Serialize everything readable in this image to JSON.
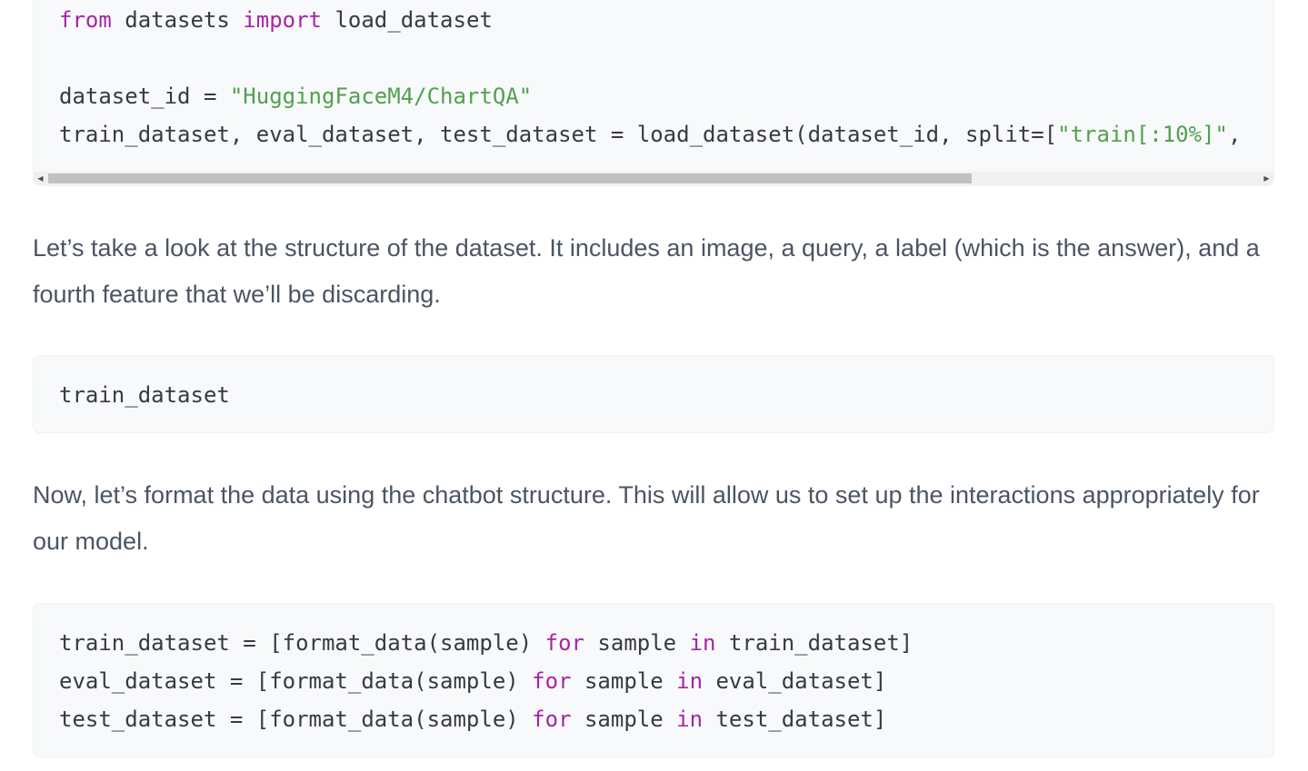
{
  "code_block_1": {
    "lines": [
      [
        {
          "t": "from",
          "k": "kw"
        },
        {
          "t": " datasets ",
          "k": ""
        },
        {
          "t": "import",
          "k": "kw"
        },
        {
          "t": " load_dataset",
          "k": ""
        }
      ],
      [],
      [
        {
          "t": "dataset_id = ",
          "k": ""
        },
        {
          "t": "\"HuggingFaceM4/ChartQA\"",
          "k": "str"
        }
      ],
      [
        {
          "t": "train_dataset, eval_dataset, test_dataset = load_dataset(dataset_id, split=[",
          "k": ""
        },
        {
          "t": "\"train[:10%]\"",
          "k": "str"
        },
        {
          "t": ",",
          "k": ""
        }
      ]
    ],
    "scroll_position": 0.75
  },
  "paragraph_1": "Let’s take a look at the structure of the dataset. It includes an image, a query, a label (which is the answer), and a fourth feature that we’ll be discarding.",
  "code_block_2": {
    "lines": [
      [
        {
          "t": "train_dataset",
          "k": ""
        }
      ]
    ]
  },
  "paragraph_2": "Now, let’s format the data using the chatbot structure. This will allow us to set up the interactions appropriately for our model.",
  "code_block_3": {
    "lines": [
      [
        {
          "t": "train_dataset = [format_data(sample) ",
          "k": ""
        },
        {
          "t": "for",
          "k": "kw"
        },
        {
          "t": " sample ",
          "k": ""
        },
        {
          "t": "in",
          "k": "kw"
        },
        {
          "t": " train_dataset]",
          "k": ""
        }
      ],
      [
        {
          "t": "eval_dataset = [format_data(sample) ",
          "k": ""
        },
        {
          "t": "for",
          "k": "kw"
        },
        {
          "t": " sample ",
          "k": ""
        },
        {
          "t": "in",
          "k": "kw"
        },
        {
          "t": " eval_dataset]",
          "k": ""
        }
      ],
      [
        {
          "t": "test_dataset = [format_data(sample) ",
          "k": ""
        },
        {
          "t": "for",
          "k": "kw"
        },
        {
          "t": " sample ",
          "k": ""
        },
        {
          "t": "in",
          "k": "kw"
        },
        {
          "t": " test_dataset]",
          "k": ""
        }
      ]
    ]
  },
  "icons": {
    "scroll_left": "scroll-left-arrow-icon",
    "scroll_right": "scroll-right-arrow-icon"
  },
  "colors": {
    "keyword": "#a626a4",
    "string": "#50a14f",
    "code_text": "#383a42",
    "prose_text": "#4b5563",
    "code_bg": "#f8f9fa"
  }
}
